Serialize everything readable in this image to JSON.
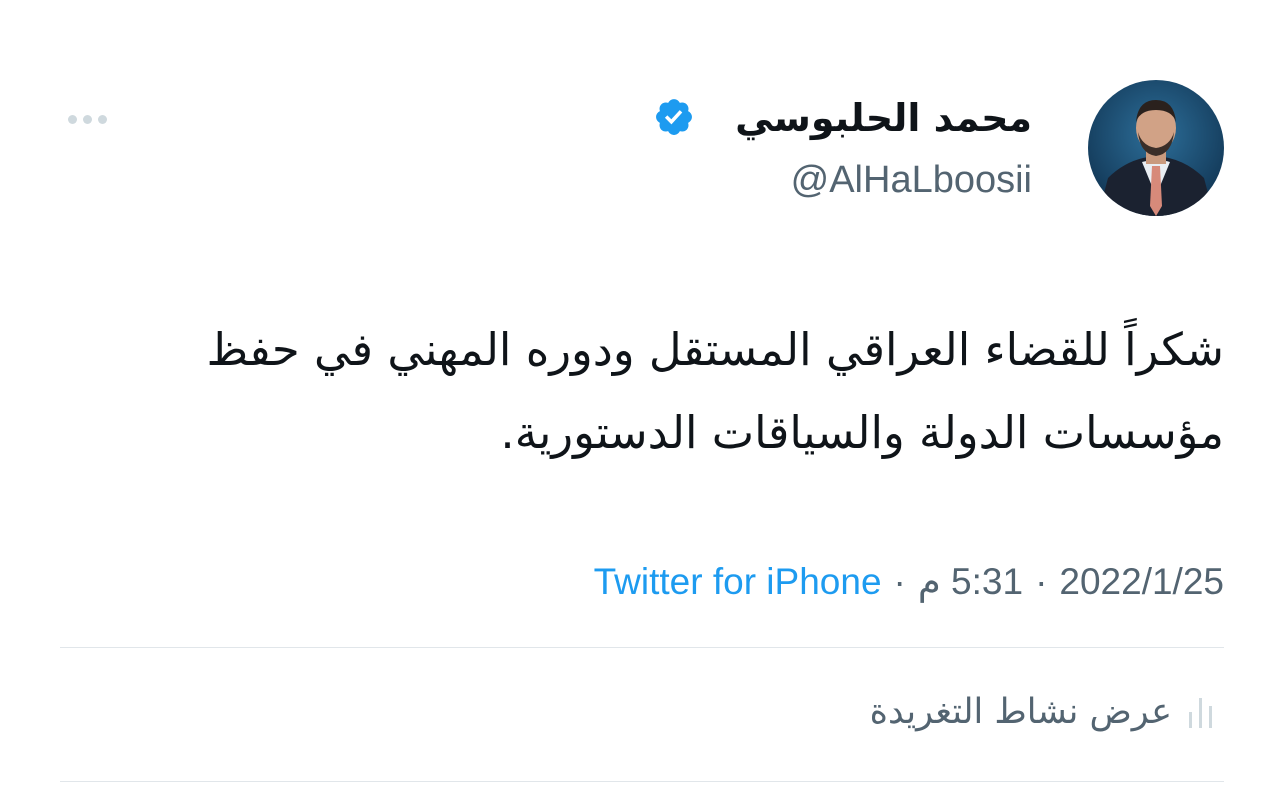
{
  "user": {
    "display_name": "محمد الحلبوسي",
    "handle": "@AlHaLboosii",
    "verified": true
  },
  "tweet": {
    "text": "شكراً للقضاء العراقي المستقل ودوره المهني في حفظ مؤسسات الدولة والسياقات الدستورية."
  },
  "meta": {
    "date": "2022/1/25",
    "time": "5:31 م",
    "separator": "·",
    "source": "Twitter for iPhone"
  },
  "actions": {
    "activity_label": "عرض نشاط التغريدة"
  },
  "colors": {
    "accent": "#1d9bf0",
    "secondary_text": "#536471",
    "divider": "#e1e6ea"
  },
  "icons": {
    "verified": "verified-badge-icon",
    "more": "more-options-icon",
    "activity": "analytics-icon"
  }
}
